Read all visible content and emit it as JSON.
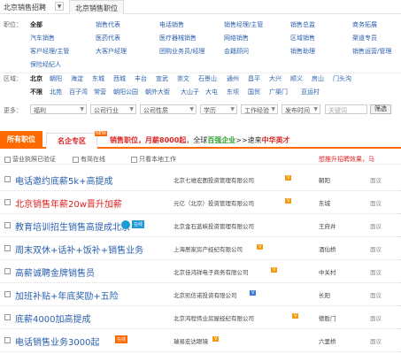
{
  "topbar": {
    "city": "北京销售招聘",
    "city_arrow": "▼",
    "tab": "北京销售职位"
  },
  "filter": {
    "category_label": "职位：",
    "categories_row1": [
      "全部",
      "销售代表",
      "电话销售",
      "销售经理/主管",
      "销售总监",
      "商务拓展"
    ],
    "categories_row2": [
      "汽车销售",
      "医药代表",
      "医疗器械销售",
      "网络销售",
      "区域销售",
      "渠道专员"
    ],
    "categories_row3": [
      "客户经理/主管",
      "大客户经理",
      "团购业务员/经理",
      "会籍顾问",
      "销售助理",
      "销售运营/管理"
    ],
    "categories_row4": [
      "保险经纪人"
    ],
    "area_label": "区域：",
    "areas": [
      "北京",
      "朝阳",
      "海淀",
      "东城",
      "西城",
      "丰台",
      "宣武",
      "崇文",
      "石景山",
      "通州",
      "昌平",
      "大兴",
      "顺义",
      "房山",
      "门头沟"
    ],
    "subareas": [
      "不限",
      "北苑",
      "百子湾",
      "常营",
      "朝阳公园",
      "朝外大街",
      "大山子",
      "大屯",
      "东坝",
      "国贸",
      "广渠门",
      "亚运村"
    ],
    "more_label": "更多：",
    "selects": [
      {
        "label": "福利",
        "arrow": "▼"
      },
      {
        "label": "公司行业",
        "arrow": "▼"
      },
      {
        "label": "公司性质",
        "arrow": "▼"
      },
      {
        "label": "学历",
        "arrow": "▼"
      },
      {
        "label": "工作经验",
        "arrow": "▼"
      },
      {
        "label": "发布时间",
        "arrow": "▼"
      }
    ],
    "keyword_placeholder": "关键词",
    "filter_button": "筛选"
  },
  "bar": {
    "tab_all": "所有职位",
    "tab_famous": "名企专区",
    "new_badge": "NEW",
    "promo_pre": "销售职位，月薪",
    "promo_salary": "8000起",
    "promo_mid": "，全球",
    "promo_green": "百强企业",
    "promo_post": ">>速来",
    "promo_red": "中华英才"
  },
  "options": {
    "opt1": "营业执照已验证",
    "opt2": "有简在线",
    "opt3": "只看本地工作",
    "tip": "想推升招聘效果，马"
  },
  "jobs": [
    {
      "title": "电话邀约底薪5k+高提成",
      "company": "北京七维宏图投资管理有限公司",
      "badge": "V",
      "loc": "朝阳",
      "salary": "面议"
    },
    {
      "title": "北京销售年薪20w晋升加薪",
      "company": "元亿（北京）投资管理有限公司",
      "badge": "V",
      "loc": "东城",
      "salary": "面议"
    },
    {
      "title": "教育培训招生销售高提成北京",
      "company": "北京金石蓝峡投资管理有限公司",
      "badge": "",
      "loc": "王府井",
      "salary": "面议"
    },
    {
      "title": "周末双休+话补+饭补+销售业务",
      "company": "上海居家房产经纪有限公司",
      "badge": "V",
      "loc": "酒仙桥",
      "salary": "面议"
    },
    {
      "title": "高薪诚聘金牌销售员",
      "company": "北京佳鸿祥电子商务有限公司",
      "badge": "V",
      "loc": "中关村",
      "salary": "面议"
    },
    {
      "title": "加班补贴+年底奖励+五险",
      "company": "北京凯信诺投资有限公司",
      "badge": "V",
      "loc": "长阳",
      "salary": "面议"
    },
    {
      "title": "底薪4000加高提成",
      "company": "北京鸿程伟业房屋经纪有限公司",
      "badge": "V",
      "loc": "德胜门",
      "salary": "面议"
    },
    {
      "title": "电话销售业务3000起",
      "company": "瑞易宏达眼镜",
      "badge": "V",
      "loc": "六里桥",
      "salary": "面议"
    }
  ],
  "job_extras": {
    "online": "在线",
    "hot": "在线"
  },
  "colors": {
    "accent": "#ff6a00",
    "link": "#2a5fae",
    "red": "#dd2222"
  }
}
